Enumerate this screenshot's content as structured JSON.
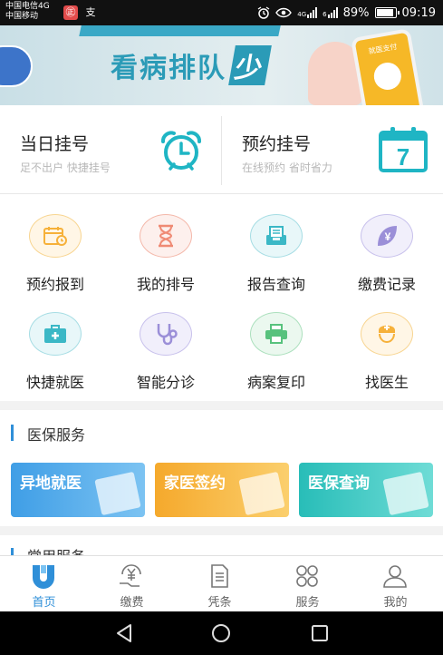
{
  "status_bar": {
    "carrier1": "中国电信4G",
    "carrier2": "中国移动",
    "app_glyph_1": "㊣",
    "app_glyph_2": "支",
    "net_label_1": "4G",
    "net_label_2": "6",
    "battery": "89%",
    "time": "09:19"
  },
  "banner": {
    "text": "看病排队",
    "badge": "少",
    "phone_title": "就医支付"
  },
  "registration": {
    "same_day": {
      "title": "当日挂号",
      "subtitle": "足不出户 快捷挂号",
      "icon": "alarm-clock-icon"
    },
    "appointment": {
      "title": "预约挂号",
      "subtitle": "在线预约 省时省力",
      "icon": "calendar-icon",
      "calendar_day": "7"
    }
  },
  "services": [
    {
      "label": "预约报到",
      "icon": "calendar-checkin-icon",
      "color": "#f6b13a",
      "bg": "#fff6e6"
    },
    {
      "label": "我的排号",
      "icon": "hourglass-icon",
      "color": "#ef8a74",
      "bg": "#fdf0ed"
    },
    {
      "label": "报告查询",
      "icon": "report-tray-icon",
      "color": "#3bb8c6",
      "bg": "#e8f7f9"
    },
    {
      "label": "缴费记录",
      "icon": "yen-leaf-icon",
      "color": "#9b8fd8",
      "bg": "#f1effb"
    },
    {
      "label": "快捷就医",
      "icon": "medical-kit-icon",
      "color": "#3bb8c6",
      "bg": "#e8f7f9"
    },
    {
      "label": "智能分诊",
      "icon": "stethoscope-icon",
      "color": "#9b8fd8",
      "bg": "#f1effb"
    },
    {
      "label": "病案复印",
      "icon": "printer-icon",
      "color": "#58c27d",
      "bg": "#ebf8ef"
    },
    {
      "label": "找医生",
      "icon": "nurse-cap-icon",
      "color": "#f6b13a",
      "bg": "#fff6e6"
    }
  ],
  "insurance": {
    "title": "医保服务",
    "cards": [
      {
        "label": "异地就医",
        "color": "#4aa7ea"
      },
      {
        "label": "家医签约",
        "color": "#f7b437"
      },
      {
        "label": "医保查询",
        "color": "#35c5c0"
      }
    ]
  },
  "common": {
    "title": "常用服务"
  },
  "tabs": [
    {
      "label": "首页",
      "icon": "home-j-icon"
    },
    {
      "label": "缴费",
      "icon": "yen-payment-icon"
    },
    {
      "label": "凭条",
      "icon": "receipt-icon"
    },
    {
      "label": "服务",
      "icon": "grid-services-icon"
    },
    {
      "label": "我的",
      "icon": "profile-icon"
    }
  ]
}
